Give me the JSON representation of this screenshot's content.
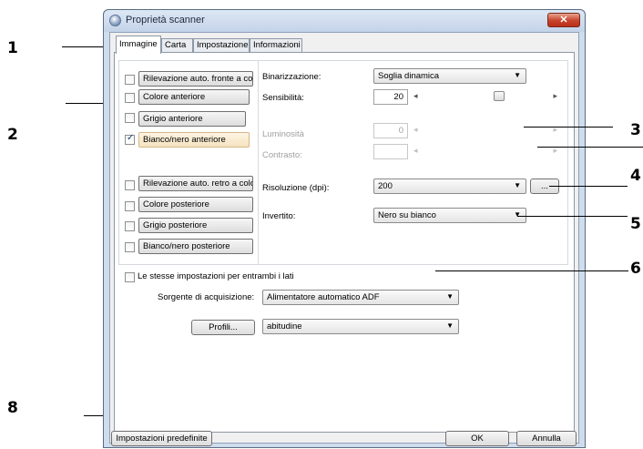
{
  "callouts": [
    "1",
    "2",
    "3",
    "4",
    "5",
    "6",
    "8"
  ],
  "window": {
    "title": "Proprietà scanner",
    "close_glyph": "✕"
  },
  "tabs": [
    "Immagine",
    "Carta",
    "Impostazione",
    "Informazioni"
  ],
  "image_options": [
    {
      "label": "Rilevazione auto. fronte a colo",
      "checked": false,
      "selected": false
    },
    {
      "label": "Colore anteriore",
      "checked": false,
      "selected": false
    },
    {
      "label": "Grigio anteriore",
      "checked": false,
      "selected": false
    },
    {
      "label": "Bianco/nero anteriore",
      "checked": true,
      "selected": true
    },
    {
      "label": "Rilevazione auto. retro a color",
      "checked": false,
      "selected": false
    },
    {
      "label": "Colore posteriore",
      "checked": false,
      "selected": false
    },
    {
      "label": "Grigio posteriore",
      "checked": false,
      "selected": false
    },
    {
      "label": "Bianco/nero posteriore",
      "checked": false,
      "selected": false
    }
  ],
  "settings": {
    "binarization_label": "Binarizzazione:",
    "binarization_value": "Soglia dinamica",
    "sensitivity_label": "Sensibilità:",
    "sensitivity_value": "20",
    "brightness_label": "Luminosità",
    "brightness_value": "0",
    "contrast_label": "Contrasto:",
    "contrast_value": "",
    "resolution_label": "Risoluzione (dpi):",
    "resolution_value": "200",
    "resolution_more": "...",
    "invert_label": "Invertito:",
    "invert_value": "Nero su bianco",
    "slider_left_arrow": "◂",
    "slider_right_arrow": "▸",
    "combo_arrow": "▼"
  },
  "same_settings_label": "Le stesse impostazioni per entrambi i lati",
  "source": {
    "label": "Sorgente di acquisizione:",
    "value": "Alimentatore automatico ADF"
  },
  "profiles": {
    "button": "Profili...",
    "value": "abitudine"
  },
  "footer": {
    "defaults_button": "Impostazioni predefinite",
    "ok_button": "OK",
    "cancel_button": "Annulla"
  },
  "colors": {
    "titlebar": "#c3d3e8",
    "close": "#c7422b",
    "selected_option": "#f6e3bf"
  }
}
